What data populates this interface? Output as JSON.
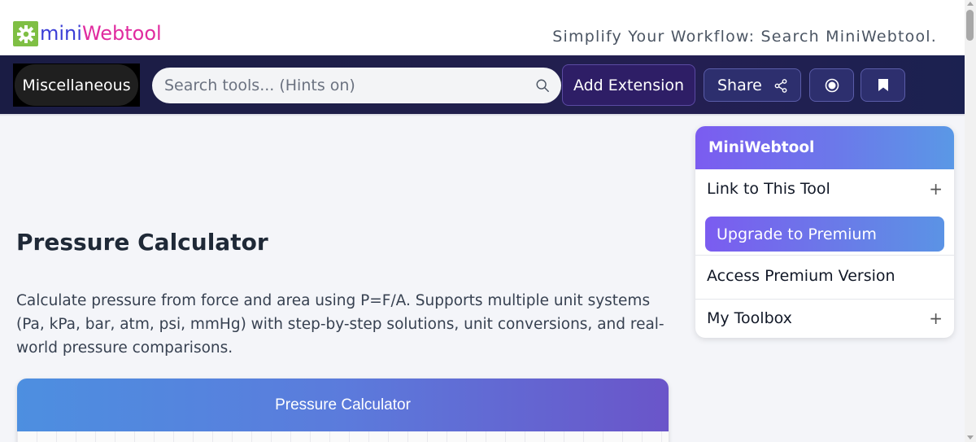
{
  "header": {
    "logo_icon": "gear-icon",
    "logo_mini": "mini",
    "logo_webtool": "Webtool",
    "tagline": "Simplify Your Workflow: Search MiniWebtool."
  },
  "nav": {
    "category_label": "Miscellaneous",
    "search_placeholder": "Search tools... (Hints on)",
    "search_icon": "search-icon",
    "add_extension_label": "Add Extension",
    "share_label": "Share",
    "share_icon": "share-icon",
    "record_icon": "record-icon",
    "bookmark_icon": "bookmark-icon"
  },
  "main": {
    "title": "Pressure Calculator",
    "description": "Calculate pressure from force and area using P=F/A. Supports multiple unit systems (Pa, kPa, bar, atm, psi, mmHg) with step-by-step solutions, unit conversions, and real-world pressure comparisons.",
    "calculator_title": "Pressure Calculator"
  },
  "sidebar": {
    "heading": "MiniWebtool",
    "link_to_tool": "Link to This Tool",
    "upgrade": "Upgrade to Premium",
    "access_premium": "Access Premium Version",
    "toolbox": "My Toolbox",
    "expand_symbol": "+"
  },
  "colors": {
    "navbar": "#1f1f4a",
    "accent_purple": "#7b5cf0",
    "accent_blue": "#5a98e6",
    "logo_green": "#7fbf44",
    "logo_blue": "#3b3ed6",
    "logo_pink": "#e02b9f"
  }
}
